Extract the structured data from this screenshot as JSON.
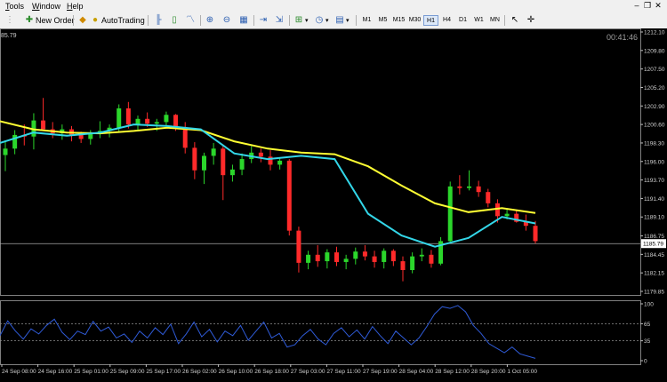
{
  "menu": [
    {
      "label": "Tools",
      "hotkey": "T",
      "rest": "ools"
    },
    {
      "label": "Window",
      "hotkey": "W",
      "rest": "indow"
    },
    {
      "label": "Help",
      "hotkey": "H",
      "rest": "elp"
    }
  ],
  "toolbar": {
    "new_order": "New Order",
    "auto_trading": "AutoTrading",
    "timeframes": [
      "M1",
      "M5",
      "M15",
      "M30",
      "H1",
      "H4",
      "D1",
      "W1",
      "MN"
    ],
    "active_timeframe": "H1"
  },
  "chart": {
    "top_left_value": "85.79",
    "clock": "00:41:46",
    "current_price": "1185.79",
    "price_ticks": [
      "1212.10",
      "1209.80",
      "1207.50",
      "1205.20",
      "1202.90",
      "1200.60",
      "1198.30",
      "1196.00",
      "1193.70",
      "1191.40",
      "1189.10",
      "1186.75",
      "1184.45",
      "1182.15",
      "1179.85"
    ],
    "osc_ticks": [
      "100",
      "65",
      "35",
      "0"
    ],
    "time_labels": [
      "24 Sep 08:00",
      "24 Sep 16:00",
      "25 Sep 01:00",
      "25 Sep 09:00",
      "25 Sep 17:00",
      "26 Sep 02:00",
      "26 Sep 10:00",
      "26 Sep 18:00",
      "27 Sep 03:00",
      "27 Sep 11:00",
      "27 Sep 19:00",
      "28 Sep 04:00",
      "28 Sep 12:00",
      "28 Sep 20:00",
      "1 Oct 05:00"
    ],
    "colors": {
      "bull": "#2bd62b",
      "bear": "#ff2a2a",
      "ma_slow": "#ffff33",
      "ma_fast": "#33d6e8",
      "osc": "#2f5bd8"
    }
  },
  "chart_data": {
    "type": "candlestick",
    "ylim": [
      1179.85,
      1212.1
    ],
    "slow_ma": [
      1201.0,
      1200.0,
      1199.6,
      1199.5,
      1199.8,
      1200.2,
      1199.9,
      1198.5,
      1197.6,
      1197.1,
      1196.9,
      1195.4,
      1193.0,
      1190.8,
      1189.7,
      1190.2,
      1189.6
    ],
    "fast_ma": [
      1198.3,
      1199.6,
      1199.2,
      1199.6,
      1200.6,
      1200.4,
      1200.0,
      1197.0,
      1196.3,
      1196.7,
      1196.3,
      1189.5,
      1186.8,
      1185.4,
      1186.5,
      1189.1,
      1188.3
    ],
    "oscillator": [
      44,
      70,
      52,
      38,
      56,
      47,
      62,
      73,
      50,
      37,
      52,
      46,
      69,
      52,
      59,
      40,
      47,
      32,
      52,
      40,
      58,
      46,
      64,
      30,
      47,
      68,
      42,
      55,
      33,
      52,
      44,
      62,
      36,
      52,
      68,
      40,
      48,
      24,
      28,
      44,
      55,
      38,
      28,
      48,
      58,
      42,
      54,
      38,
      60,
      44,
      30,
      52,
      40,
      28,
      40,
      60,
      82,
      95,
      92,
      97,
      86,
      62,
      48,
      30,
      22,
      14,
      24,
      12,
      8,
      4
    ],
    "candles": [
      {
        "o": 1196.8,
        "h": 1198.6,
        "l": 1194.8,
        "c": 1197.6
      },
      {
        "o": 1197.6,
        "h": 1199.9,
        "l": 1196.9,
        "c": 1199.3
      },
      {
        "o": 1199.3,
        "h": 1200.6,
        "l": 1198.0,
        "c": 1199.1
      },
      {
        "o": 1199.1,
        "h": 1202.0,
        "l": 1197.5,
        "c": 1201.1
      },
      {
        "o": 1201.1,
        "h": 1203.9,
        "l": 1200.3,
        "c": 1200.0
      },
      {
        "o": 1200.0,
        "h": 1200.9,
        "l": 1198.9,
        "c": 1199.5
      },
      {
        "o": 1199.5,
        "h": 1200.6,
        "l": 1198.7,
        "c": 1200.0
      },
      {
        "o": 1200.0,
        "h": 1200.4,
        "l": 1198.5,
        "c": 1199.3
      },
      {
        "o": 1199.3,
        "h": 1199.7,
        "l": 1198.3,
        "c": 1198.8
      },
      {
        "o": 1198.8,
        "h": 1199.9,
        "l": 1198.1,
        "c": 1199.5
      },
      {
        "o": 1199.5,
        "h": 1201.0,
        "l": 1198.9,
        "c": 1199.8
      },
      {
        "o": 1199.8,
        "h": 1200.6,
        "l": 1199.0,
        "c": 1200.2
      },
      {
        "o": 1200.2,
        "h": 1203.1,
        "l": 1199.6,
        "c": 1202.6
      },
      {
        "o": 1202.6,
        "h": 1203.4,
        "l": 1200.1,
        "c": 1200.6
      },
      {
        "o": 1200.6,
        "h": 1201.7,
        "l": 1199.9,
        "c": 1201.3
      },
      {
        "o": 1201.3,
        "h": 1202.1,
        "l": 1200.3,
        "c": 1200.7
      },
      {
        "o": 1200.7,
        "h": 1201.3,
        "l": 1199.8,
        "c": 1200.9
      },
      {
        "o": 1200.9,
        "h": 1202.2,
        "l": 1200.4,
        "c": 1201.8
      },
      {
        "o": 1201.8,
        "h": 1201.9,
        "l": 1199.8,
        "c": 1200.2
      },
      {
        "o": 1200.2,
        "h": 1200.9,
        "l": 1197.0,
        "c": 1197.7
      },
      {
        "o": 1197.7,
        "h": 1198.4,
        "l": 1193.8,
        "c": 1194.9
      },
      {
        "o": 1194.9,
        "h": 1197.1,
        "l": 1193.2,
        "c": 1196.7
      },
      {
        "o": 1196.7,
        "h": 1198.3,
        "l": 1195.6,
        "c": 1197.6
      },
      {
        "o": 1197.6,
        "h": 1198.0,
        "l": 1191.2,
        "c": 1194.3
      },
      {
        "o": 1194.3,
        "h": 1195.6,
        "l": 1193.5,
        "c": 1195.0
      },
      {
        "o": 1195.0,
        "h": 1197.0,
        "l": 1194.3,
        "c": 1196.3
      },
      {
        "o": 1196.3,
        "h": 1197.9,
        "l": 1195.8,
        "c": 1197.1
      },
      {
        "o": 1197.1,
        "h": 1197.6,
        "l": 1195.9,
        "c": 1196.6
      },
      {
        "o": 1196.6,
        "h": 1197.4,
        "l": 1194.9,
        "c": 1195.6
      },
      {
        "o": 1195.6,
        "h": 1196.5,
        "l": 1195.0,
        "c": 1196.1
      },
      {
        "o": 1196.1,
        "h": 1196.3,
        "l": 1186.8,
        "c": 1187.4
      },
      {
        "o": 1187.4,
        "h": 1187.9,
        "l": 1182.2,
        "c": 1183.4
      },
      {
        "o": 1183.4,
        "h": 1184.9,
        "l": 1182.6,
        "c": 1184.4
      },
      {
        "o": 1184.4,
        "h": 1185.6,
        "l": 1182.9,
        "c": 1183.6
      },
      {
        "o": 1183.6,
        "h": 1185.1,
        "l": 1182.7,
        "c": 1184.7
      },
      {
        "o": 1184.7,
        "h": 1185.4,
        "l": 1183.0,
        "c": 1183.5
      },
      {
        "o": 1183.5,
        "h": 1184.4,
        "l": 1182.6,
        "c": 1183.9
      },
      {
        "o": 1183.9,
        "h": 1185.3,
        "l": 1183.2,
        "c": 1184.8
      },
      {
        "o": 1184.8,
        "h": 1185.6,
        "l": 1183.7,
        "c": 1184.2
      },
      {
        "o": 1184.2,
        "h": 1184.9,
        "l": 1182.8,
        "c": 1183.5
      },
      {
        "o": 1183.5,
        "h": 1185.2,
        "l": 1182.7,
        "c": 1184.9
      },
      {
        "o": 1184.9,
        "h": 1185.1,
        "l": 1183.0,
        "c": 1183.6
      },
      {
        "o": 1183.6,
        "h": 1184.2,
        "l": 1181.1,
        "c": 1182.5
      },
      {
        "o": 1182.5,
        "h": 1184.7,
        "l": 1182.1,
        "c": 1184.2
      },
      {
        "o": 1184.2,
        "h": 1185.2,
        "l": 1183.6,
        "c": 1184.4
      },
      {
        "o": 1184.4,
        "h": 1185.0,
        "l": 1182.8,
        "c": 1183.3
      },
      {
        "o": 1183.3,
        "h": 1186.6,
        "l": 1183.1,
        "c": 1186.1
      },
      {
        "o": 1186.1,
        "h": 1193.5,
        "l": 1185.9,
        "c": 1192.9
      },
      {
        "o": 1192.9,
        "h": 1194.3,
        "l": 1191.9,
        "c": 1192.7
      },
      {
        "o": 1192.7,
        "h": 1194.9,
        "l": 1192.4,
        "c": 1192.9
      },
      {
        "o": 1192.9,
        "h": 1193.6,
        "l": 1191.6,
        "c": 1192.2
      },
      {
        "o": 1192.2,
        "h": 1192.6,
        "l": 1190.3,
        "c": 1190.8
      },
      {
        "o": 1190.8,
        "h": 1191.3,
        "l": 1188.4,
        "c": 1189.2
      },
      {
        "o": 1189.2,
        "h": 1190.1,
        "l": 1188.8,
        "c": 1189.5
      },
      {
        "o": 1189.5,
        "h": 1189.9,
        "l": 1188.4,
        "c": 1188.5
      },
      {
        "o": 1188.5,
        "h": 1189.4,
        "l": 1187.4,
        "c": 1188.0
      },
      {
        "o": 1188.0,
        "h": 1188.6,
        "l": 1185.8,
        "c": 1186.1
      }
    ]
  }
}
